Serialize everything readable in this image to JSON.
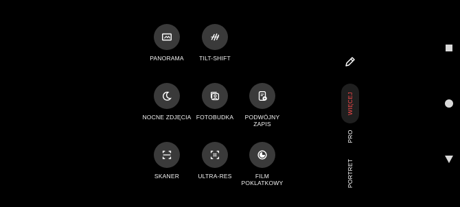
{
  "modes": [
    {
      "label": "PANORAMA",
      "icon": "panorama-icon"
    },
    {
      "label": "TILT-SHIFT",
      "icon": "tilt-shift-icon"
    },
    {
      "label": "NOCNE ZDJĘCIA",
      "icon": "moon-icon"
    },
    {
      "label": "FOTOBUDKA",
      "icon": "photobooth-icon"
    },
    {
      "label": "PODWÓJNY\nZAPIS",
      "icon": "dual-record-icon"
    },
    {
      "label": "SKANER",
      "icon": "scanner-icon"
    },
    {
      "label": "ULTRA-RES",
      "icon": "ultra-res-icon"
    },
    {
      "label": "FILM\nPOKLATKOWY",
      "icon": "timelapse-icon"
    }
  ],
  "rail": {
    "edit_icon": "pencil-icon",
    "tabs": [
      {
        "label": "WIĘCEJ",
        "active": true
      },
      {
        "label": "PRO",
        "active": false
      },
      {
        "label": "PORTRET",
        "active": false
      }
    ],
    "accent_color": "#ff4a4a"
  },
  "nav": {
    "recents": "square-icon",
    "home": "circle-icon",
    "back": "triangle-icon"
  }
}
